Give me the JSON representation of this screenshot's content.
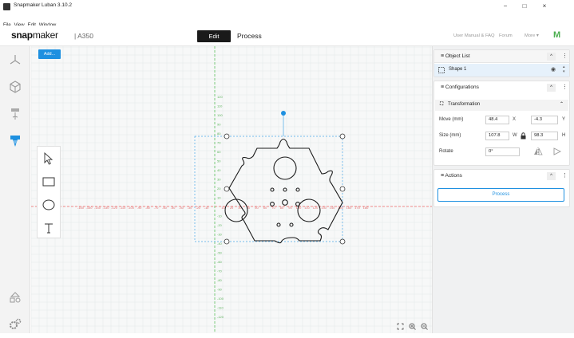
{
  "window": {
    "title": "Snapmaker Luban 3.10.2",
    "minimize": "−",
    "maximize": "□",
    "close": "×"
  },
  "menu": [
    "File",
    "View",
    "Edit",
    "Window"
  ],
  "header": {
    "logo_bold": "snap",
    "logo_light": "maker",
    "model": "| A350",
    "edit_tab": "Edit",
    "process_tab": "Process",
    "manual_link": "User Manual & FAQ",
    "forum_link": "Forum",
    "more_link": "More ▾",
    "brand_mark": "M"
  },
  "left_bar": {
    "icons": [
      "3d-printing-icon",
      "view-cube-icon",
      "laser-icon",
      "cnc-icon",
      "workspace-icon",
      "settings-icon"
    ],
    "active": "cnc-icon"
  },
  "canvas": {
    "add_button": "Add...",
    "x_ticks": [
      "-160",
      "-150",
      "-140",
      "-130",
      "-120",
      "-110",
      "-100",
      "-90",
      "-80",
      "-70",
      "-60",
      "-50",
      "-40",
      "-30",
      "-20",
      "-10",
      "",
      "10",
      "20",
      "30",
      "40",
      "50",
      "60",
      "70",
      "80",
      "90",
      "100",
      "110",
      "120",
      "130",
      "140",
      "150",
      "160",
      "170",
      "180"
    ],
    "y_ticks_top": [
      "120",
      "110",
      "100",
      "90",
      "80",
      "70",
      "60",
      "50",
      "40",
      "30",
      "20",
      "10"
    ],
    "y_ticks_bottom": [
      "-10",
      "-20",
      "-30",
      "-40",
      "-50",
      "-60",
      "-70",
      "-80",
      "-90",
      "-100",
      "-110",
      "-120"
    ],
    "tools": [
      "select-tool-icon",
      "rectangle-tool-icon",
      "ellipse-tool-icon",
      "text-tool-icon"
    ]
  },
  "right_panel": {
    "object_list": {
      "title": "Object List",
      "items": [
        {
          "name": "Shape 1"
        }
      ]
    },
    "configurations": {
      "title": "Configurations",
      "section": "Transformation",
      "move_label": "Move (mm)",
      "move_x": "48.4",
      "move_x_unit": "X",
      "move_y": "-4.3",
      "move_y_unit": "Y",
      "size_label": "Size (mm)",
      "size_w": "107.8",
      "size_w_unit": "W",
      "size_h": "98.3",
      "size_h_unit": "H",
      "rotate_label": "Rotate",
      "rotate_value": "0°"
    },
    "actions": {
      "title": "Actions",
      "process_button": "Process"
    }
  },
  "colors": {
    "accent": "#1e90e0",
    "grid_axis_x": "#ef6464",
    "grid_axis_y": "#5fc35f",
    "brand": "#4caf50"
  }
}
